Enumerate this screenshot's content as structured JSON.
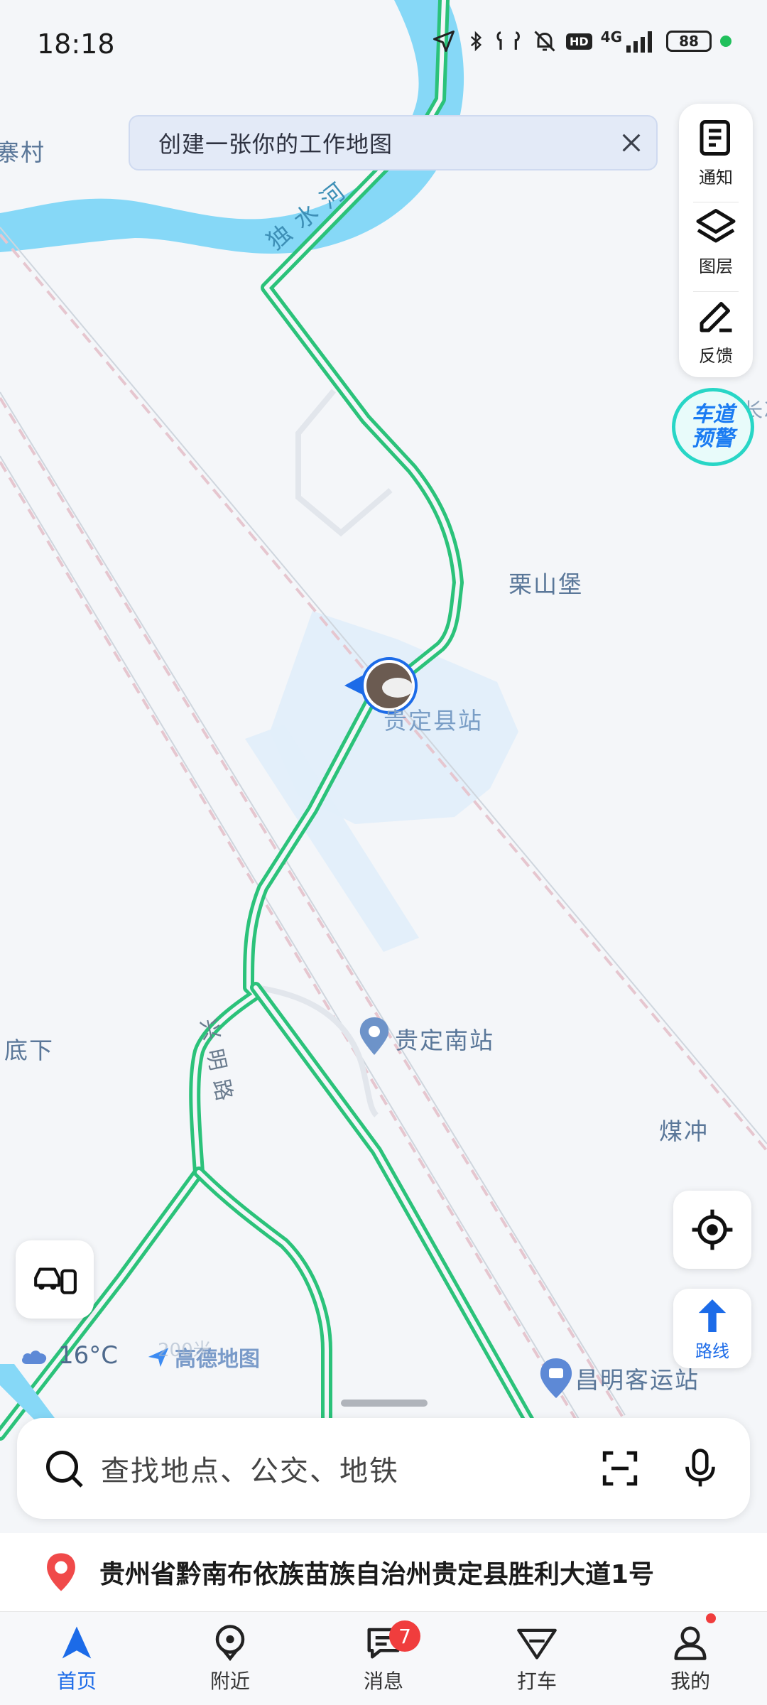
{
  "status_bar": {
    "time": "18:18",
    "network": "4G",
    "hd": "HD",
    "battery": "88"
  },
  "banner": {
    "text": "创建一张你的工作地图",
    "close_icon": "close-icon"
  },
  "right_toolbar": {
    "items": [
      {
        "label": "通知",
        "icon": "notice-icon"
      },
      {
        "label": "图层",
        "icon": "layers-icon"
      },
      {
        "label": "反馈",
        "icon": "feedback-pen-icon"
      }
    ],
    "lane_alert": [
      "车道",
      "预警"
    ]
  },
  "map": {
    "labels": {
      "village_left": "寨村",
      "river": "独 水 河",
      "lishanbao": "栗山堡",
      "guiding_station": "贵定县站",
      "guiding_south": "贵定南站",
      "dixia": "底下",
      "meichong": "煤冲",
      "xingming_road": "兴 明 路",
      "changming_bus": "昌明客运站",
      "edge_right": "长冲"
    },
    "weather": "16°C",
    "scale": "200米",
    "logo": "高德地图"
  },
  "route_button_label": "路线",
  "search": {
    "placeholder": "查找地点、公交、地铁"
  },
  "address": "贵州省黔南布依族苗族自治州贵定县胜利大道1号",
  "bottom_nav": [
    {
      "label": "首页",
      "icon": "home-nav-icon",
      "active": true
    },
    {
      "label": "附近",
      "icon": "nearby-icon"
    },
    {
      "label": "消息",
      "icon": "message-icon",
      "badge": "7"
    },
    {
      "label": "打车",
      "icon": "taxi-icon"
    },
    {
      "label": "我的",
      "icon": "profile-icon"
    }
  ],
  "colors": {
    "river": "#86d8f7",
    "road": "#2bc27a",
    "accent": "#1c6be8",
    "badge": "#f03d3d"
  }
}
